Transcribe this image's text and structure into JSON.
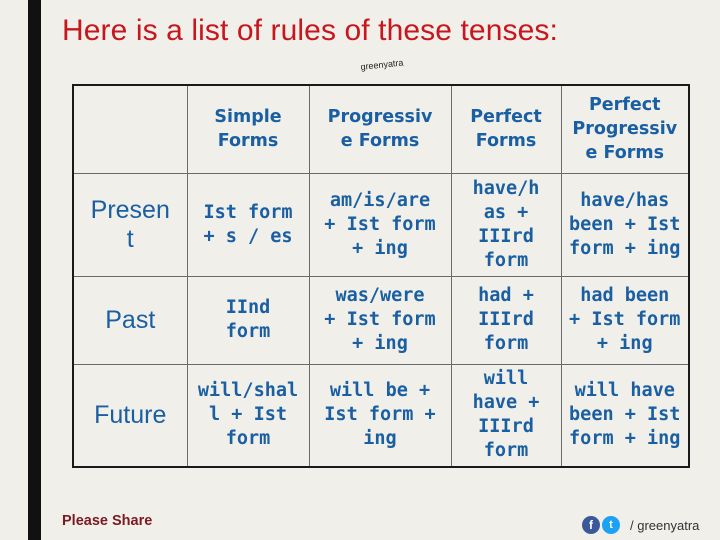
{
  "title": "Here is a list of rules of these tenses:",
  "watermark": "greenyatra",
  "table": {
    "headers": [
      "",
      "Simple\nForms",
      "Progressiv\ne Forms",
      "Perfect\nForms",
      "Perfect\nProgressiv\ne Forms"
    ],
    "rows": [
      {
        "label": "Presen\nt",
        "cells": [
          "Ist form\n+ s / es",
          "am/is/are\n+ Ist form\n+ ing",
          "have/h\nas +\nIIIrd\nform",
          "have/has\nbeen + Ist\nform + ing"
        ]
      },
      {
        "label": "Past",
        "cells": [
          "IInd\nform",
          "was/were\n+ Ist form\n+ ing",
          "had +\nIIIrd\nform",
          "had been\n+ Ist form\n+ ing"
        ]
      },
      {
        "label": "Future",
        "cells": [
          "will/shal\nl + Ist\nform",
          "will be +\nIst form +\ning",
          "will\nhave +\nIIIrd\nform",
          "will have\nbeen + Ist\nform + ing"
        ]
      }
    ]
  },
  "footer": {
    "share_label": "Please Share",
    "facebook_glyph": "f",
    "twitter_glyph": "t",
    "handle": "/ greenyatra"
  },
  "colors": {
    "title": "#c8161d",
    "table_text": "#1a5fa2",
    "background": "#f1efea",
    "left_bar": "#111111",
    "share_text": "#7a1a22"
  },
  "icons": [
    "facebook-icon",
    "twitter-icon"
  ]
}
